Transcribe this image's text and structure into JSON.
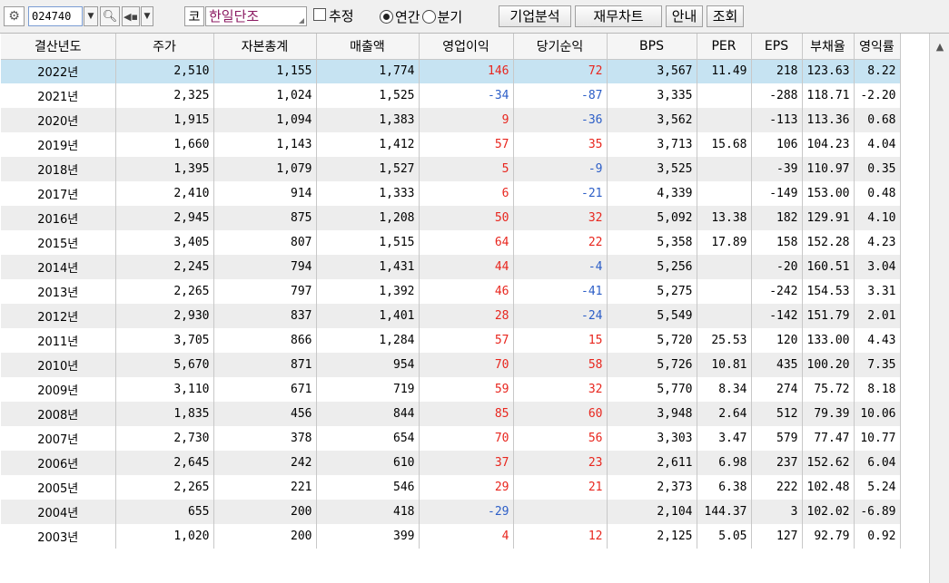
{
  "toolbar": {
    "code": "024740",
    "market_badge": "코",
    "company": "한일단조",
    "estimate_label": "추정",
    "annual_label": "연간",
    "quarter_label": "분기",
    "btn_company": "기업분석",
    "btn_chart": "재무차트",
    "btn_guide": "안내",
    "btn_query": "조회"
  },
  "table": {
    "headers": [
      "결산년도",
      "주가",
      "자본총계",
      "매출액",
      "영업이익",
      "당기순익",
      "BPS",
      "PER",
      "EPS",
      "부채율",
      "영익률"
    ],
    "rows": [
      [
        "2022년",
        "2,510",
        "1,155",
        "1,774",
        "146",
        "72",
        "3,567",
        "11.49",
        "218",
        "123.63",
        "8.22"
      ],
      [
        "2021년",
        "2,325",
        "1,024",
        "1,525",
        "-34",
        "-87",
        "3,335",
        "",
        "-288",
        "118.71",
        "-2.20"
      ],
      [
        "2020년",
        "1,915",
        "1,094",
        "1,383",
        "9",
        "-36",
        "3,562",
        "",
        "-113",
        "113.36",
        "0.68"
      ],
      [
        "2019년",
        "1,660",
        "1,143",
        "1,412",
        "57",
        "35",
        "3,713",
        "15.68",
        "106",
        "104.23",
        "4.04"
      ],
      [
        "2018년",
        "1,395",
        "1,079",
        "1,527",
        "5",
        "-9",
        "3,525",
        "",
        "-39",
        "110.97",
        "0.35"
      ],
      [
        "2017년",
        "2,410",
        "914",
        "1,333",
        "6",
        "-21",
        "4,339",
        "",
        "-149",
        "153.00",
        "0.48"
      ],
      [
        "2016년",
        "2,945",
        "875",
        "1,208",
        "50",
        "32",
        "5,092",
        "13.38",
        "182",
        "129.91",
        "4.10"
      ],
      [
        "2015년",
        "3,405",
        "807",
        "1,515",
        "64",
        "22",
        "5,358",
        "17.89",
        "158",
        "152.28",
        "4.23"
      ],
      [
        "2014년",
        "2,245",
        "794",
        "1,431",
        "44",
        "-4",
        "5,256",
        "",
        "-20",
        "160.51",
        "3.04"
      ],
      [
        "2013년",
        "2,265",
        "797",
        "1,392",
        "46",
        "-41",
        "5,275",
        "",
        "-242",
        "154.53",
        "3.31"
      ],
      [
        "2012년",
        "2,930",
        "837",
        "1,401",
        "28",
        "-24",
        "5,549",
        "",
        "-142",
        "151.79",
        "2.01"
      ],
      [
        "2011년",
        "3,705",
        "866",
        "1,284",
        "57",
        "15",
        "5,720",
        "25.53",
        "120",
        "133.00",
        "4.43"
      ],
      [
        "2010년",
        "5,670",
        "871",
        "954",
        "70",
        "58",
        "5,726",
        "10.81",
        "435",
        "100.20",
        "7.35"
      ],
      [
        "2009년",
        "3,110",
        "671",
        "719",
        "59",
        "32",
        "5,770",
        "8.34",
        "274",
        "75.72",
        "8.18"
      ],
      [
        "2008년",
        "1,835",
        "456",
        "844",
        "85",
        "60",
        "3,948",
        "2.64",
        "512",
        "79.39",
        "10.06"
      ],
      [
        "2007년",
        "2,730",
        "378",
        "654",
        "70",
        "56",
        "3,303",
        "3.47",
        "579",
        "77.47",
        "10.77"
      ],
      [
        "2006년",
        "2,645",
        "242",
        "610",
        "37",
        "23",
        "2,611",
        "6.98",
        "237",
        "152.62",
        "6.04"
      ],
      [
        "2005년",
        "2,265",
        "221",
        "546",
        "29",
        "21",
        "2,373",
        "6.38",
        "222",
        "102.48",
        "5.24"
      ],
      [
        "2004년",
        "655",
        "200",
        "418",
        "-29",
        "",
        "2,104",
        "144.37",
        "3",
        "102.02",
        "-6.89"
      ],
      [
        "2003년",
        "1,020",
        "200",
        "399",
        "4",
        "12",
        "2,125",
        "5.05",
        "127",
        "92.79",
        "0.92"
      ]
    ]
  },
  "colors": {
    "positive": "#e8261e",
    "negative": "#2c5ec7",
    "selected_row": "#c6e3f2"
  },
  "icons": [
    "gear-icon",
    "dropdown-arrow-icon",
    "search-icon",
    "speaker-icon",
    "resize-grip-icon",
    "scroll-up-arrow-icon"
  ]
}
